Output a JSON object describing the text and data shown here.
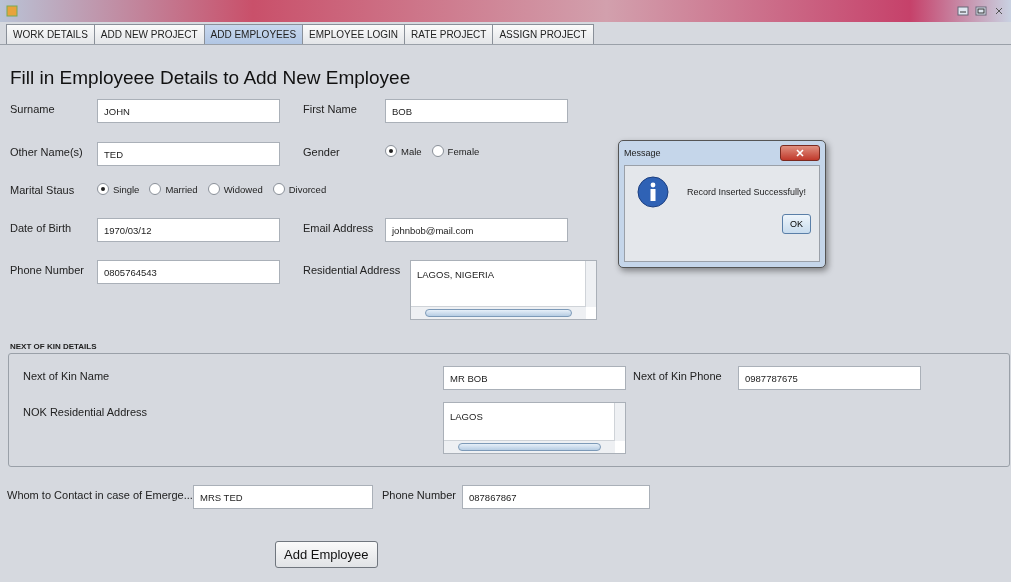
{
  "tabs": [
    {
      "label": "WORK DETAILS",
      "selected": false
    },
    {
      "label": "ADD NEW PROJECT",
      "selected": false
    },
    {
      "label": "ADD EMPLOYEES",
      "selected": true
    },
    {
      "label": "EMPLOYEE LOGIN",
      "selected": false
    },
    {
      "label": "RATE PROJECT",
      "selected": false
    },
    {
      "label": "ASSIGN PROJECT",
      "selected": false
    }
  ],
  "heading": "Fill in Employeee Details to Add New Employee",
  "rows": [
    [
      {
        "kind": "text",
        "label": "Surname",
        "value": "JOHN"
      },
      {
        "kind": "text",
        "label": "First Name",
        "value": "BOB"
      }
    ],
    [
      {
        "kind": "text",
        "label": "Other Name(s)",
        "value": "TED"
      },
      {
        "kind": "radio",
        "label": "Gender",
        "options": [
          {
            "label": "Male",
            "selected": true
          },
          {
            "label": "Female",
            "selected": false
          }
        ]
      }
    ],
    [
      {
        "kind": "radio",
        "label": "Marital Staus",
        "options": [
          {
            "label": "Single",
            "selected": true
          },
          {
            "label": "Married",
            "selected": false
          },
          {
            "label": "Widowed",
            "selected": false
          },
          {
            "label": "Divorced",
            "selected": false
          }
        ]
      }
    ],
    [
      {
        "kind": "text",
        "label": "Date of Birth",
        "value": "1970/03/12"
      },
      {
        "kind": "text",
        "label": "Email Address",
        "value": "johnbob@mail.com"
      }
    ],
    [
      {
        "kind": "text",
        "label": "Phone Number",
        "value": "0805764543"
      },
      {
        "kind": "textarea",
        "label": "Residential Address",
        "value": "LAGOS, NIGERIA"
      }
    ]
  ],
  "next_of_kin": {
    "title": "NEXT OF KIN DETAILS",
    "name": {
      "label": "Next of Kin Name",
      "value": "MR BOB"
    },
    "phone": {
      "label": "Next of Kin Phone",
      "value": "0987787675"
    },
    "address": {
      "label": "NOK Residential Address",
      "value": "LAGOS"
    }
  },
  "emergency": {
    "contact": {
      "label": "Whom to Contact in case of Emerge...",
      "value": "MRS TED"
    },
    "phone": {
      "label": "Phone Number",
      "value": "087867867"
    }
  },
  "submit_button": "Add Employee",
  "dialog": {
    "title": "Message",
    "message": "Record Inserted Successfully!",
    "button": "OK"
  }
}
